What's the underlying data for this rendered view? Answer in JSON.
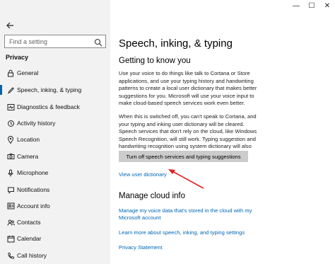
{
  "window": {
    "controls": [
      {
        "name": "minimize",
        "glyph": "—"
      },
      {
        "name": "maximize",
        "glyph": "☐"
      },
      {
        "name": "close",
        "glyph": "✕"
      }
    ]
  },
  "sidebar": {
    "search": {
      "placeholder": "Find a setting"
    },
    "section": "Privacy",
    "items": [
      {
        "label": "General",
        "icon": "lock-icon",
        "active": false
      },
      {
        "label": "Speech, inking, & typing",
        "icon": "pen-icon",
        "active": true
      },
      {
        "label": "Diagnostics & feedback",
        "icon": "diagnostics-icon",
        "active": false
      },
      {
        "label": "Activity history",
        "icon": "history-icon",
        "active": false
      },
      {
        "label": "Location",
        "icon": "location-icon",
        "active": false
      },
      {
        "label": "Camera",
        "icon": "camera-icon",
        "active": false
      },
      {
        "label": "Microphone",
        "icon": "microphone-icon",
        "active": false
      },
      {
        "label": "Notifications",
        "icon": "notifications-icon",
        "active": false
      },
      {
        "label": "Account info",
        "icon": "account-icon",
        "active": false
      },
      {
        "label": "Contacts",
        "icon": "contacts-icon",
        "active": false
      },
      {
        "label": "Calendar",
        "icon": "calendar-icon",
        "active": false
      },
      {
        "label": "Call history",
        "icon": "call-history-icon",
        "active": false
      }
    ]
  },
  "main": {
    "title": "Speech, inking, & typing",
    "section1": {
      "heading": "Getting to know you",
      "para1": "Use your voice to do things like talk to Cortana or Store applications, and use your typing history and handwriting patterns to create a local user dictionary that makes better suggestions for you. Microsoft will use your voice input to make cloud-based speech services work even better.",
      "para2": "When this is switched off, you can't speak to Cortana, and your typing and inking user dictionary will be cleared. Speech services that don't rely on the cloud, like Windows Speech Recognition, will still work. Typing suggestion and handwriting recognition using system dictionary will also continue to work.",
      "button": "Turn off speech services and typing suggestions",
      "link": "View user dictionary"
    },
    "section2": {
      "heading": "Manage cloud info",
      "links": [
        "Manage my voice data that's stored in the cloud with my Microsoft account",
        "Learn more about speech, inking, and typing settings",
        "Privacy Statement"
      ]
    }
  },
  "colors": {
    "accent": "#0063b1",
    "link": "#0066b4",
    "sidebar_bg": "#f2f2f2",
    "button_bg": "#cccccc",
    "annotation_arrow": "#e02020"
  }
}
